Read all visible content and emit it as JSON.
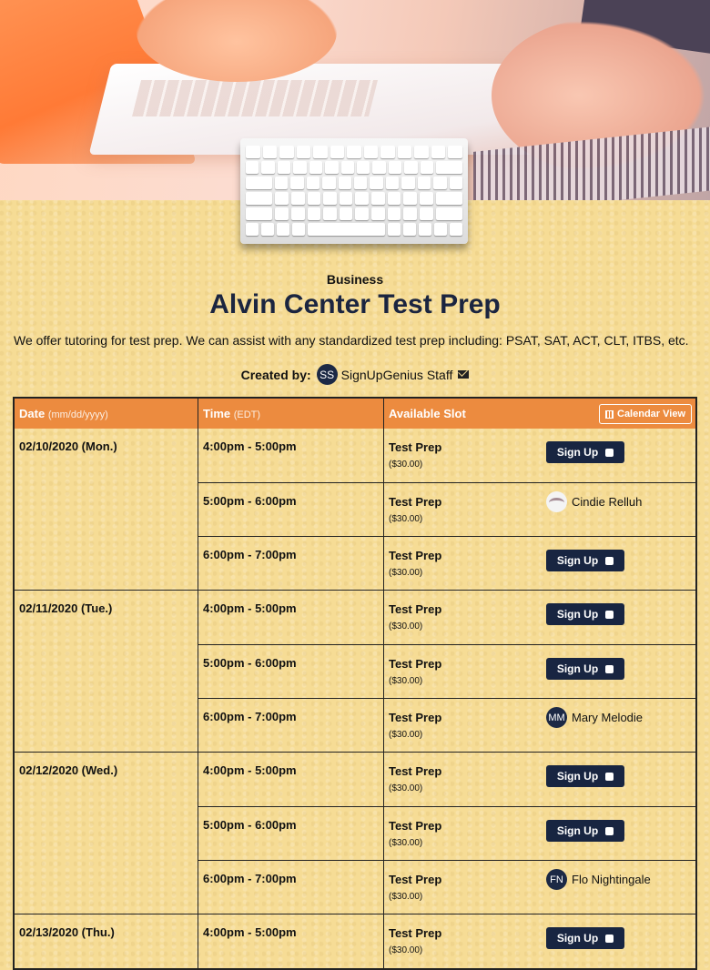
{
  "header": {
    "category": "Business",
    "title": "Alvin Center Test Prep",
    "description": "We offer tutoring for test prep.  We can assist with any standardized test prep including: PSAT, SAT, ACT, CLT, ITBS, etc.",
    "created_by_label": "Created by:",
    "creator_initials": "SS",
    "creator_name": "SignUpGenius Staff"
  },
  "table": {
    "col_date": "Date",
    "col_date_hint": "(mm/dd/yyyy)",
    "col_time": "Time",
    "col_time_hint": "(EDT)",
    "col_slot": "Available Slot",
    "calendar_view": "Calendar View",
    "signup_label": "Sign Up",
    "groups": [
      {
        "date": "02/10/2020 (Mon.)",
        "slots": [
          {
            "time": "4:00pm - 5:00pm",
            "name": "Test Prep",
            "price": "($30.00)"
          },
          {
            "time": "5:00pm - 6:00pm",
            "name": "Test Prep",
            "price": "($30.00)",
            "person": "Cindie Relluh"
          },
          {
            "time": "6:00pm - 7:00pm",
            "name": "Test Prep",
            "price": "($30.00)"
          }
        ]
      },
      {
        "date": "02/11/2020 (Tue.)",
        "slots": [
          {
            "time": "4:00pm - 5:00pm",
            "name": "Test Prep",
            "price": "($30.00)"
          },
          {
            "time": "5:00pm - 6:00pm",
            "name": "Test Prep",
            "price": "($30.00)"
          },
          {
            "time": "6:00pm - 7:00pm",
            "name": "Test Prep",
            "price": "($30.00)",
            "person": "Mary Melodie",
            "initials": "MM"
          }
        ]
      },
      {
        "date": "02/12/2020 (Wed.)",
        "slots": [
          {
            "time": "4:00pm - 5:00pm",
            "name": "Test Prep",
            "price": "($30.00)"
          },
          {
            "time": "5:00pm - 6:00pm",
            "name": "Test Prep",
            "price": "($30.00)"
          },
          {
            "time": "6:00pm - 7:00pm",
            "name": "Test Prep",
            "price": "($30.00)",
            "person": "Flo Nightingale",
            "initials": "FN"
          }
        ]
      },
      {
        "date": "02/13/2020 (Thu.)",
        "slots": [
          {
            "time": "4:00pm - 5:00pm",
            "name": "Test Prep",
            "price": "($30.00)"
          }
        ]
      }
    ]
  }
}
